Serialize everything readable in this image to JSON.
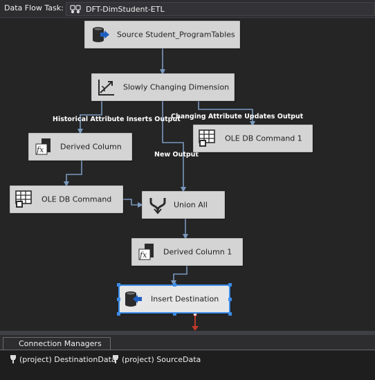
{
  "header": {
    "task_label": "Data Flow Task:",
    "task_value": "DFT-DimStudent-ETL",
    "task_icon": "data-flow-task-icon"
  },
  "components": [
    {
      "label": "Source Student_ProgramTables",
      "icon": "database-source-icon",
      "selected": false
    },
    {
      "label": "Slowly Changing Dimension",
      "icon": "slowly-changing-dimension-icon",
      "selected": false
    },
    {
      "label": "OLE DB Command 1",
      "icon": "ole-db-command-icon",
      "selected": false
    },
    {
      "label": "Derived Column",
      "icon": "derived-column-icon",
      "selected": false
    },
    {
      "label": "OLE DB Command",
      "icon": "ole-db-command-icon",
      "selected": false
    },
    {
      "label": "Union All",
      "icon": "union-all-icon",
      "selected": false
    },
    {
      "label": "Derived Column 1",
      "icon": "derived-column-icon",
      "selected": false
    },
    {
      "label": "Insert Destination",
      "icon": "database-destination-icon",
      "selected": true
    }
  ],
  "path_labels": {
    "historical": "Historical Attribute Inserts Output",
    "changing": "Changing Attribute Updates Output",
    "new": "New Output"
  },
  "connection_managers": {
    "tab_label": "Connection Managers",
    "items": [
      {
        "label": "(project) DestinationData",
        "icon": "connection-plug-icon"
      },
      {
        "label": "(project) SourceData",
        "icon": "connection-plug-icon"
      }
    ]
  },
  "colors": {
    "canvas": "#252526",
    "component": "#d4d4d4",
    "path": "#7a99bd",
    "selection": "#3c8ce7",
    "error_output": "#c0392b"
  }
}
